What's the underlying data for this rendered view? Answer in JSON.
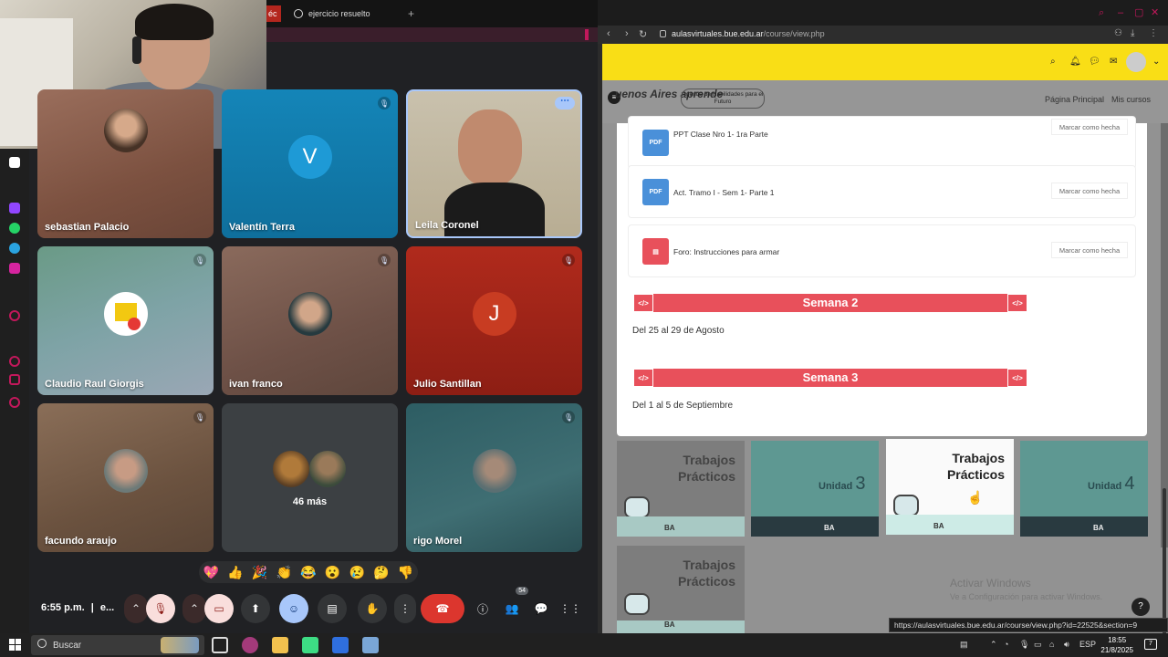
{
  "meet": {
    "tabs": [
      {
        "label": "éc"
      },
      {
        "label": "ejercicio resuelto"
      }
    ],
    "participants": [
      {
        "name": "sebastian Palacio"
      },
      {
        "name": "Valentín Terra",
        "initial": "V"
      },
      {
        "name": "Leila Coronel"
      },
      {
        "name": "Claudio Raul Giorgis"
      },
      {
        "name": "ivan franco"
      },
      {
        "name": "Julio Santillan",
        "initial": "J"
      },
      {
        "name": "facundo araujo"
      },
      {
        "name": "46 más"
      },
      {
        "name": "rigo Morel"
      }
    ],
    "reactions": [
      "💖",
      "👍",
      "🎉",
      "👏",
      "😂",
      "😮",
      "😢",
      "🤔",
      "👎"
    ],
    "controls": {
      "time": "6:55 p.m.",
      "meeting_code": "e...",
      "participants_count": "54"
    },
    "colors": {
      "end_call": "#dc362e",
      "active_border": "#a8c7fa"
    }
  },
  "browser": {
    "url_domain": "aulasvirtuales.bue.edu.ar",
    "url_path": "/course/view.php",
    "nav": {
      "logo": "uenos Aires aprende",
      "badge": "Agenda de Habilidades para el Futuro",
      "home": "Página Principal",
      "my_courses": "Mis cursos"
    },
    "activities": [
      {
        "type": "PDF",
        "title": "PPT Clase Nro 1- 1ra Parte",
        "action": "Marcar como hecha"
      },
      {
        "type": "PDF",
        "title": "Act. Tramo I - Sem 1- Parte 1",
        "action": "Marcar como hecha"
      },
      {
        "type": "forum",
        "title": "Foro: Instrucciones para armar",
        "action": "Marcar como hecha"
      }
    ],
    "weeks": [
      {
        "title": "Semana 2",
        "dates": "Del 25 al 29 de Agosto"
      },
      {
        "title": "Semana 3",
        "dates": "Del 1 al 5 de Septiembre"
      }
    ],
    "thumbnails": [
      {
        "title_line1": "Trabajos",
        "title_line2": "Prácticos"
      },
      {
        "unit_label": "Unidad",
        "unit_number": "3"
      },
      {
        "title_line1": "Trabajos",
        "title_line2": "Prácticos"
      },
      {
        "unit_label": "Unidad",
        "unit_number": "4"
      },
      {
        "title_line1": "Trabajos",
        "title_line2": "Prácticos"
      }
    ],
    "thumb_brand": "BA",
    "watermark_title": "Activar Windows",
    "watermark_sub": "Ve a Configuración para activar Windows.",
    "status_url": "https://aulasvirtuales.bue.edu.ar/course/view.php?id=22525&section=9",
    "colors": {
      "header_yellow": "#f9de16",
      "week_red": "#e8505b"
    }
  },
  "taskbar": {
    "search_placeholder": "Buscar",
    "language": "ESP",
    "time": "18:55",
    "date": "21/8/2025",
    "notifications": "7"
  }
}
